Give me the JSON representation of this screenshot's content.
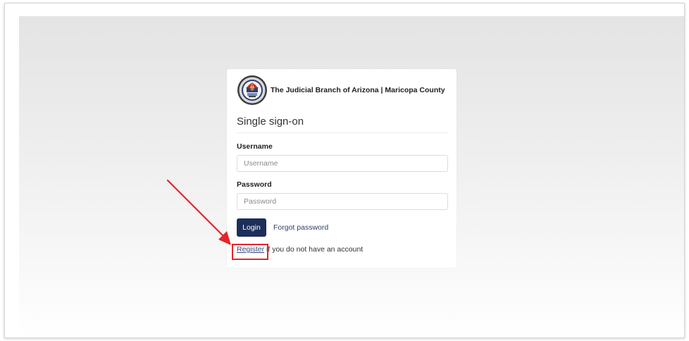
{
  "brand": {
    "title": "The Judicial Branch of Arizona | Maricopa County",
    "logo_icon": "arizona-judicial-seal-icon"
  },
  "form": {
    "heading": "Single sign-on",
    "username_label": "Username",
    "username_placeholder": "Username",
    "username_value": "",
    "password_label": "Password",
    "password_placeholder": "Password",
    "password_value": "",
    "login_label": "Login",
    "forgot_label": "Forgot password",
    "register_link": "Register",
    "register_suffix": " if you do not have an account"
  },
  "annotation": {
    "arrow_icon": "red-arrow-icon",
    "highlight_color": "#e3262b"
  },
  "colors": {
    "primary": "#1d2e5a",
    "link": "#2e3f6e"
  }
}
